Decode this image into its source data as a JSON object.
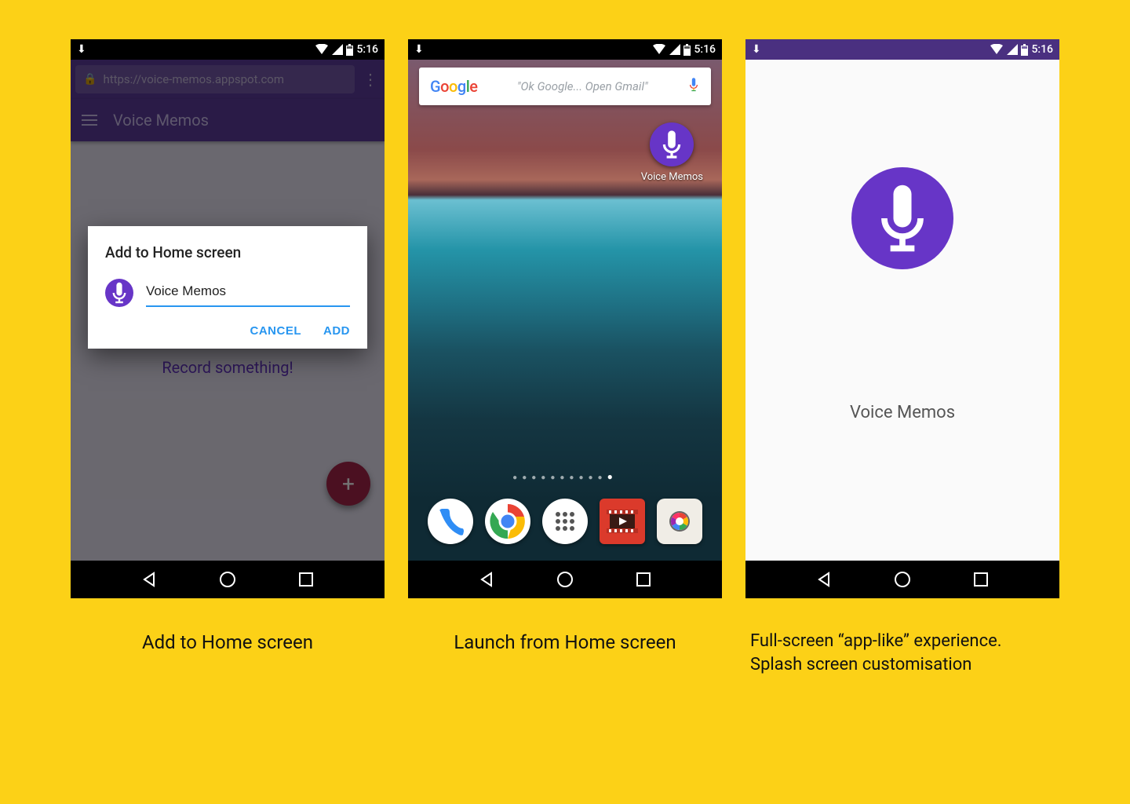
{
  "status": {
    "time": "5:16"
  },
  "phone1": {
    "url": "https://voice-memos.appspot.com",
    "app_title": "Voice Memos",
    "empty_message": "Record something!",
    "dialog": {
      "title": "Add to Home screen",
      "input_value": "Voice Memos",
      "cancel": "CANCEL",
      "add": "ADD"
    }
  },
  "phone2": {
    "search_hint": "\"Ok Google... Open Gmail\"",
    "icon_label": "Voice Memos"
  },
  "phone3": {
    "splash_label": "Voice Memos"
  },
  "captions": {
    "c1": "Add to Home screen",
    "c2": "Launch from Home screen",
    "c3": "Full-screen “app-like” experience. Splash screen customisation"
  }
}
